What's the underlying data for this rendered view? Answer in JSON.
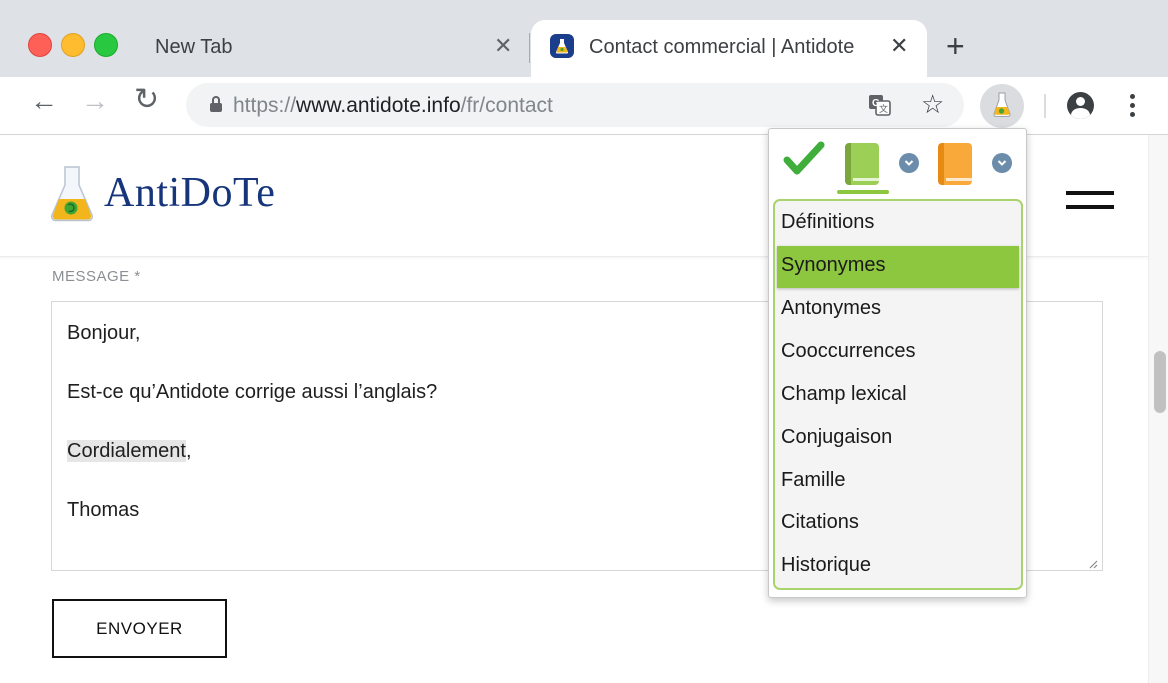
{
  "browser": {
    "tabs": [
      {
        "title": "New Tab",
        "active": false
      },
      {
        "title": "Contact commercial | Antidote",
        "active": true
      }
    ],
    "url": {
      "scheme": "https://",
      "host": "www.antidote.info",
      "path": "/fr/contact"
    },
    "icons": [
      "close-icon",
      "new-tab-icon",
      "back-icon",
      "forward-icon",
      "reload-icon",
      "lock-icon",
      "translate-icon",
      "star-icon",
      "antidote-extension-icon",
      "profile-icon",
      "menu-icon"
    ]
  },
  "site": {
    "logo_text": "AntiDoTe",
    "message_label": "MESSAGE *",
    "message_lines": [
      "Bonjour,",
      "Est-ce qu’Antidote corrige aussi l’anglais?",
      "Cordialement",
      ",",
      "Thomas"
    ],
    "send_label": "ENVOYER"
  },
  "popup": {
    "items": [
      "Définitions",
      "Synonymes",
      "Antonymes",
      "Cooccurrences",
      "Champ lexical",
      "Conjugaison",
      "Famille",
      "Citations",
      "Historique"
    ],
    "selected": "Synonymes"
  },
  "colors": {
    "accent_green": "#8dc63f",
    "brand_blue": "#16357a",
    "book_orange": "#f8a93a"
  }
}
